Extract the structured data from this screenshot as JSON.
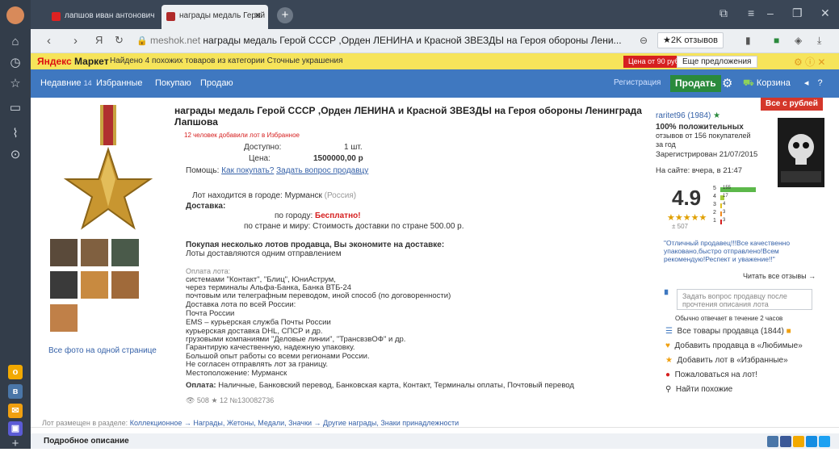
{
  "browser": {
    "tabs": [
      {
        "label": "лапшов иван антонович"
      },
      {
        "label": "награды медаль Герой"
      }
    ],
    "url_host": "meshok.net",
    "url_path": "награды медаль Герой СССР ,Орден ЛЕНИНА и Красной ЗВЕЗДЫ на Героя обороны Лени...",
    "reviews_btn": "★2K отзывов"
  },
  "ymbar": {
    "logo_a": "Яндекс",
    "logo_b": "Маркет",
    "text": "Найдено 4 похожих товаров из категории Сточные украшения",
    "price_btn": "Цена от 90 руб.",
    "offers_btn": "Еще предложения ⌄"
  },
  "sitenav": {
    "new_label": "Недавние",
    "new_count": "14",
    "favorites": "Избранные",
    "purchases": "Покупаю",
    "sales": "Продаю",
    "register": "Регистрация",
    "sell": "Продать",
    "cart": "Корзина",
    "badge": "Все с рублей"
  },
  "lot": {
    "title": "награды медаль Герой СССР ,Орден ЛЕНИНА и Красной ЗВЕЗДЫ на Героя обороны Ленинграда Лапшова",
    "fav_note": "12 человек добавили лот в Избранное",
    "avail_label": "Доступно:",
    "avail_value": "1 шт.",
    "price_label": "Цена:",
    "price_value": "1500000,00 р",
    "help_label": "Помощь:",
    "help_link1": "Как покупать?",
    "help_link2": "Задать вопрос продавцу",
    "city_label": "Лот находится в городе:",
    "city_value": "Мурманск",
    "city_country": "(Россия)",
    "delivery_label": "Доставка:",
    "delivery_city": "по городу:",
    "delivery_free": "Бесплатно!",
    "delivery_world": "по стране и миру:  Стоимость доставки по стране 500.00 р.",
    "save_heading": "Покупая несколько лотов продавца, Вы экономите на доставке:",
    "save_sub": "Лоты доставляются одним отправлением",
    "payment_lines": [
      "Оплата лота:",
      "системами \"Контакт\", \"Блиц\", ЮниАструм,",
      "через терминалы Альфа-Банка, Банка ВТБ-24",
      "почтовым или телеграфным переводом, иной способ (по договоренности)",
      "Доставка лота по всей России:",
      "Почта России",
      "EMS – курьерская служба Почты России",
      "курьерская доставка DHL, СПСР и др.",
      "грузовыми компаниями \"Деловые линии\", \"ТрансвзвОФ\" и др.",
      "Гарантирую качественную, надежную упаковку.",
      "Большой опыт работы со всеми регионами России.",
      "Не согласен отправлять лот за границу.",
      "Местоположение: Мурманск"
    ],
    "payment_footer_label": "Оплата:",
    "payment_footer": "Наличные, Банковский перевод, Банковская карта, Контакт, Терминалы оплаты, Почтовый перевод",
    "stats": "👁 508  ★ 12  №130082736",
    "all_photos": "Все фото на одной странице",
    "category_prefix": "Лот размещен в разделе:",
    "category_path": "Коллекционное → Награды, Жетоны, Медали, Значки → Другие награды, Знаки принадлежности",
    "details": "Подробное описание"
  },
  "seller": {
    "name": "raritet96 (1984)",
    "positive": "100% положительных",
    "positive2": "отзывов от 156 покупателей",
    "positive3": "за год",
    "registered": "Зарегистрирован 21/07/2015",
    "last_seen": "На сайте: вчера, в 21:47",
    "rating": "4.9",
    "stars": "★★★★★",
    "votes": "± 507",
    "bar_labels": [
      "5",
      "4",
      "3",
      "2",
      "1"
    ],
    "bar_values": [
      "155",
      "17",
      "4",
      "3",
      "3"
    ],
    "quote": "\"Отличный продавец!!!Все качественно упаковано,быстро отправлено!Всем рекомендую!Респект и уважение!!\"",
    "read_all": "Читать все отзывы →",
    "question_placeholder": "Задать вопрос продавцу после прочтения описания лота",
    "reply_note": "Обычно отвечает в течение 2 часов",
    "all_lots": "Все товары продавца (1844)",
    "add_fav_seller": "Добавить продавца в «Любимые»",
    "add_fav_lot": "Добавить лот в «Избранные»",
    "complain": "Пожаловаться на лот!",
    "similar": "Найти похожие"
  }
}
